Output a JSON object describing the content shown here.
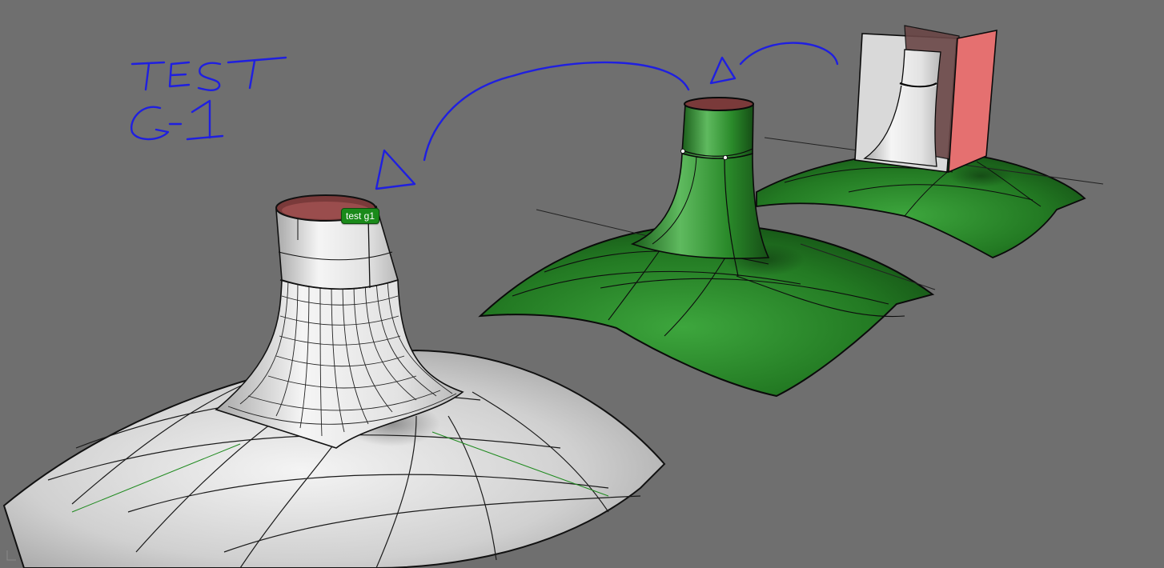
{
  "viewport": {
    "background": "#6f6f6f",
    "annotation_tag": {
      "label": "test g1",
      "color": "#1a8a1a"
    },
    "sketch_text": {
      "line1": "TEST",
      "line2": "G1",
      "ink_color": "#1f1fe0"
    },
    "models": [
      {
        "name": "white-surface-g1",
        "color": "#e6e6e6"
      },
      {
        "name": "green-surface",
        "color": "#2a8a2a"
      },
      {
        "name": "white-red-trimmed-model",
        "color": "#e57070"
      }
    ]
  }
}
